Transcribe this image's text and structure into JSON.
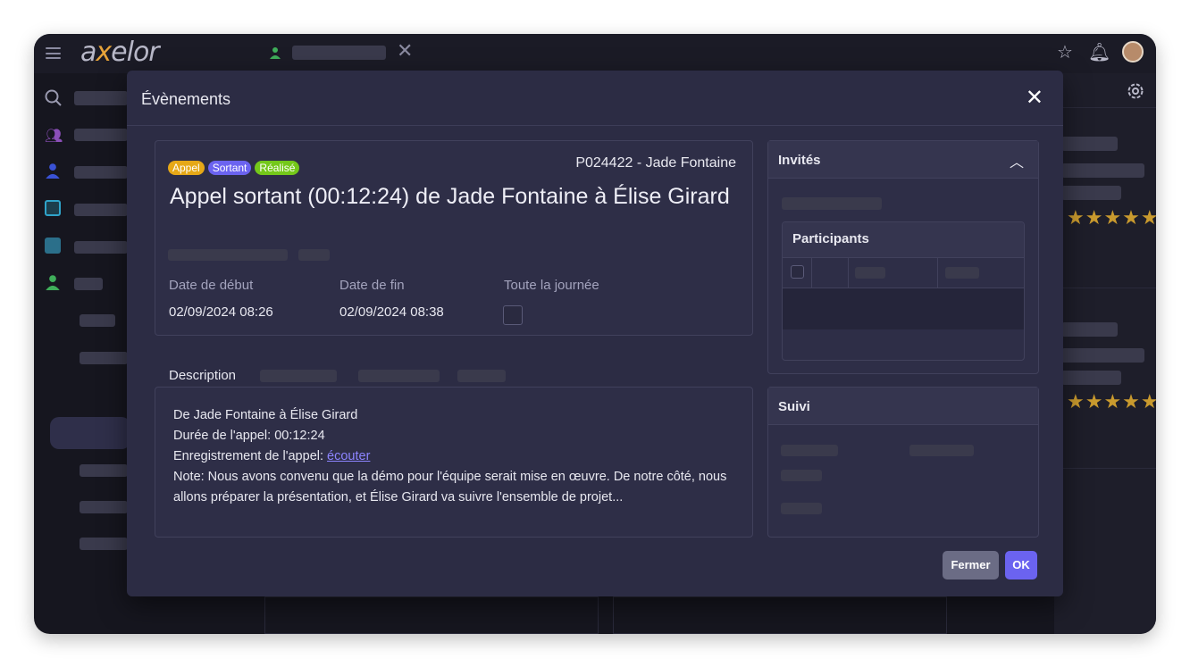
{
  "app": {
    "logo_pre": "a",
    "logo_x": "x",
    "logo_post": "elor"
  },
  "colors": {
    "accent": "#7a6ff0",
    "badge_call": "#e6a817",
    "badge_out": "#6b63f0",
    "badge_done": "#74c81a",
    "stars": "#c99a2e"
  },
  "topbar": {
    "icons": [
      "star-icon",
      "bell-icon",
      "avatar"
    ]
  },
  "background": {
    "stars_row": "★★★★★"
  },
  "modal": {
    "title": "Évènements",
    "close_label": "✕",
    "event": {
      "badges": [
        "Appel",
        "Sortant",
        "Réalisé"
      ],
      "reference": "P024422 - Jade Fontaine",
      "title": "Appel sortant (00:12:24) de Jade Fontaine à Élise Girard",
      "start_label": "Date de début",
      "start_value": "02/09/2024 08:26",
      "end_label": "Date de fin",
      "end_value": "02/09/2024 08:38",
      "allday_label": "Toute la journée",
      "allday_checked": false
    },
    "tabs": {
      "description": "Description"
    },
    "description": {
      "line1": "De Jade Fontaine à Élise Girard",
      "line2": "Durée de l'appel: 00:12:24",
      "line3_prefix": "Enregistrement de l'appel: ",
      "line3_link": "écouter",
      "line4": "Note: Nous avons convenu que la démo pour l'équipe serait mise en œuvre. De notre côté, nous allons préparer la présentation, et Élise Girard va suivre l'ensemble de projet..."
    },
    "invites": {
      "title": "Invités",
      "participants_title": "Participants"
    },
    "suivi": {
      "title": "Suivi"
    },
    "footer": {
      "close_label": "Fermer",
      "ok_label": "OK"
    }
  }
}
